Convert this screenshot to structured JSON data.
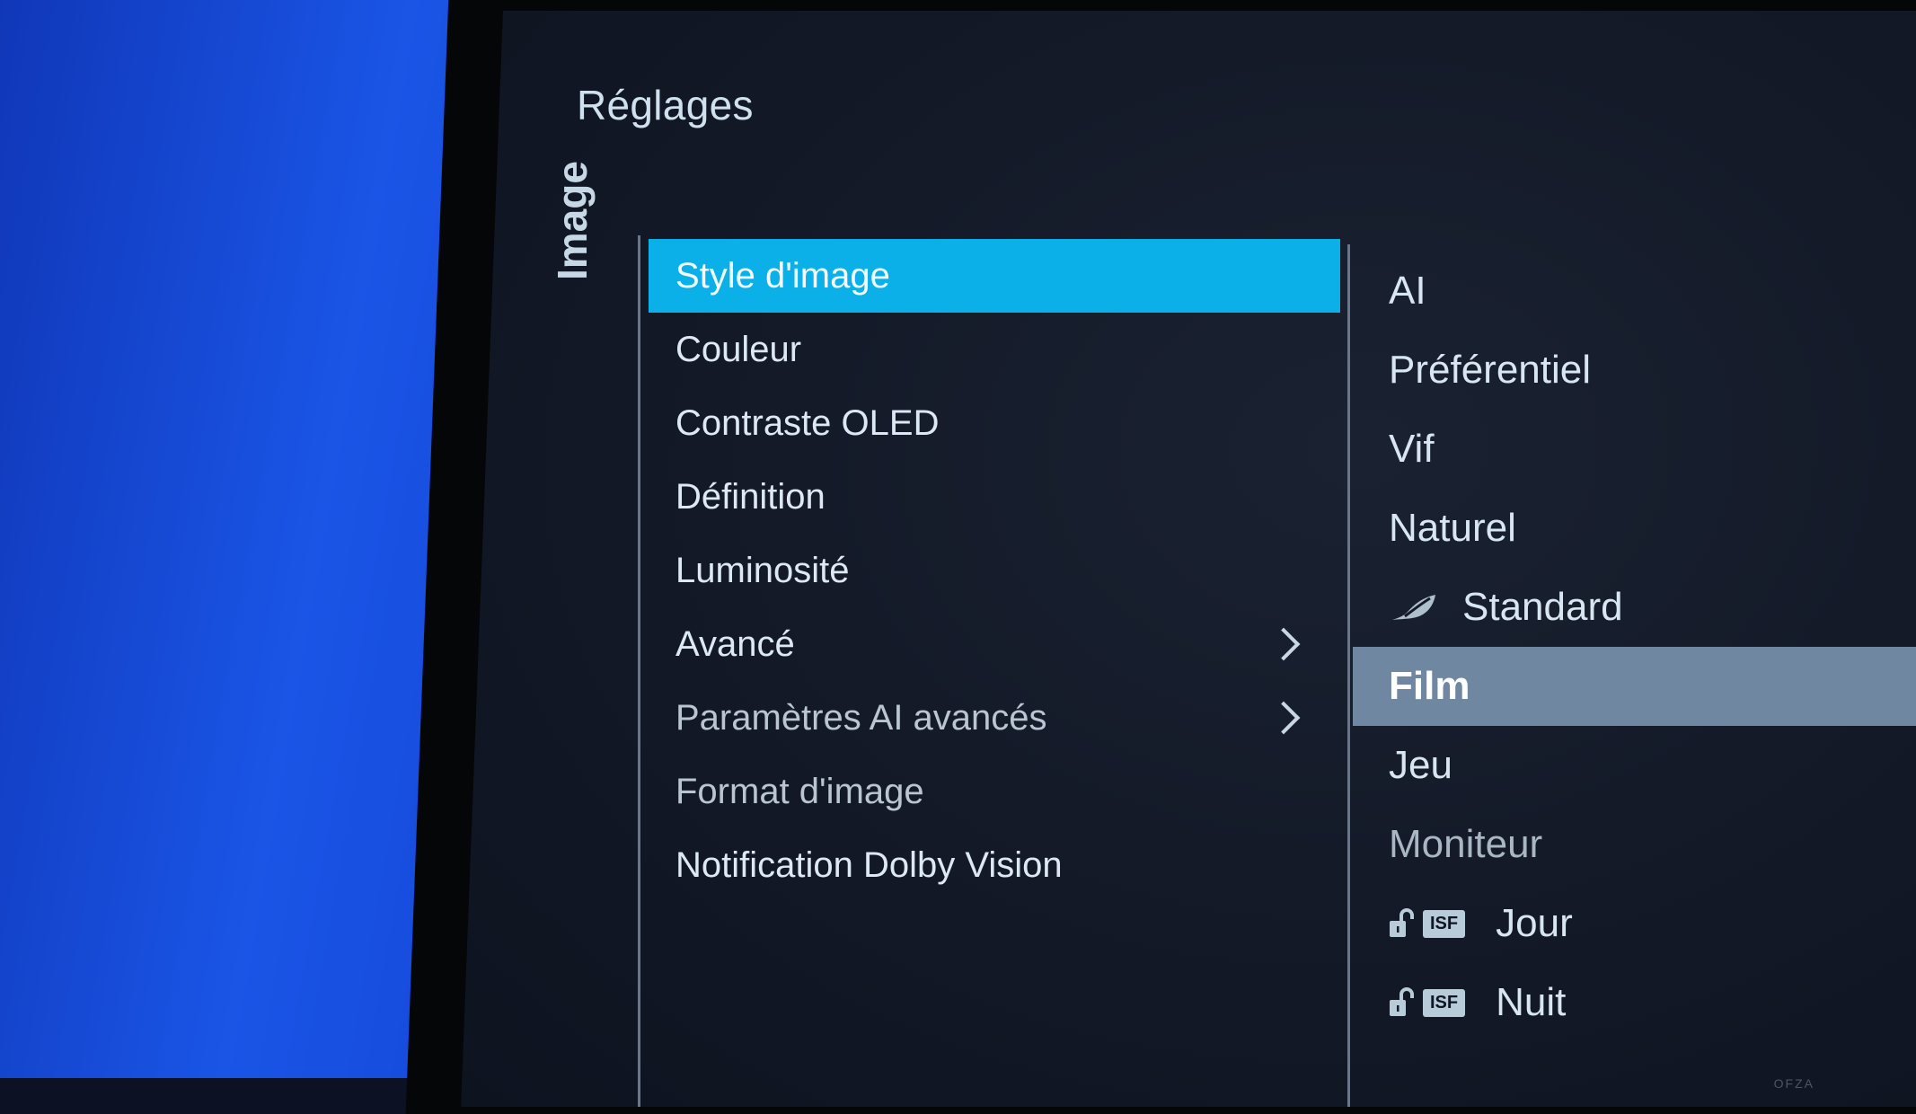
{
  "header": {
    "title": "Réglages"
  },
  "section": {
    "label": "Image"
  },
  "menu": {
    "items": [
      {
        "label": "Style d'image",
        "selected": true,
        "has_submenu": false
      },
      {
        "label": "Couleur",
        "selected": false,
        "has_submenu": false
      },
      {
        "label": "Contraste OLED",
        "selected": false,
        "has_submenu": false
      },
      {
        "label": "Définition",
        "selected": false,
        "has_submenu": false
      },
      {
        "label": "Luminosité",
        "selected": false,
        "has_submenu": false
      },
      {
        "label": "Avancé",
        "selected": false,
        "has_submenu": true
      },
      {
        "label": "Paramètres AI avancés",
        "selected": false,
        "has_submenu": true
      },
      {
        "label": "Format d'image",
        "selected": false,
        "has_submenu": false
      },
      {
        "label": "Notification Dolby Vision",
        "selected": false,
        "has_submenu": false
      }
    ]
  },
  "options": {
    "items": [
      {
        "label": "AI",
        "icon": null
      },
      {
        "label": "Préférentiel",
        "icon": null
      },
      {
        "label": "Vif",
        "icon": null
      },
      {
        "label": "Naturel",
        "icon": null
      },
      {
        "label": "Standard",
        "icon": "eco-leaf-icon"
      },
      {
        "label": "Film",
        "icon": null,
        "selected": true
      },
      {
        "label": "Jeu",
        "icon": null
      },
      {
        "label": "Moniteur",
        "icon": null
      },
      {
        "label": "Jour",
        "icon": "unlocked-padlock-icon",
        "badge": "ISF"
      },
      {
        "label": "Nuit",
        "icon": "unlocked-padlock-icon",
        "badge": "ISF"
      }
    ]
  },
  "colors": {
    "menu_highlight": "#0bb0e8",
    "option_highlight": "#6f87a1",
    "background": "#141a28"
  },
  "watermark": "OFZA"
}
